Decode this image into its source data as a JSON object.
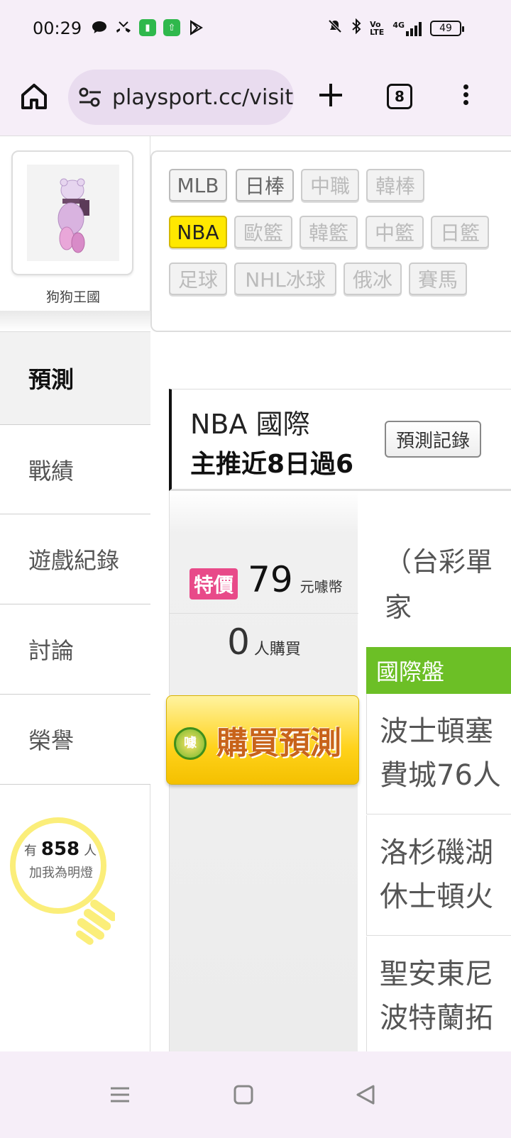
{
  "status_bar": {
    "time": "00:29",
    "battery": "49",
    "network": "4G",
    "icons": [
      "chat-bubble-icon",
      "missed-call-icon",
      "app-icon",
      "upload-icon",
      "play-store-icon",
      "mute-icon",
      "bluetooth-icon",
      "volte-icon",
      "signal-icon",
      "battery-icon"
    ]
  },
  "browser": {
    "url": "playsport.cc/visit",
    "tab_count": "8"
  },
  "sidebar": {
    "username": "狗狗王國",
    "items": [
      {
        "label": "預測",
        "active": true
      },
      {
        "label": "戰績",
        "active": false
      },
      {
        "label": "遊戲紀錄",
        "active": false
      },
      {
        "label": "討論",
        "active": false
      },
      {
        "label": "榮譽",
        "active": false
      }
    ],
    "fans": {
      "prefix": "有",
      "count": "858",
      "suffix": "人",
      "line2": "加我為明燈"
    }
  },
  "sports": [
    {
      "label": "MLB",
      "state": "enabled"
    },
    {
      "label": "日棒",
      "state": "enabled"
    },
    {
      "label": "中職",
      "state": "disabled"
    },
    {
      "label": "韓棒",
      "state": "disabled"
    },
    {
      "label": "NBA",
      "state": "selected"
    },
    {
      "label": "歐籃",
      "state": "disabled"
    },
    {
      "label": "韓籃",
      "state": "disabled"
    },
    {
      "label": "中籃",
      "state": "disabled"
    },
    {
      "label": "日籃",
      "state": "disabled"
    },
    {
      "label": "足球",
      "state": "disabled"
    },
    {
      "label": "NHL冰球",
      "state": "disabled"
    },
    {
      "label": "俄冰",
      "state": "disabled"
    },
    {
      "label": "賽馬",
      "state": "disabled"
    }
  ],
  "prediction": {
    "title": "NBA 國際",
    "subtitle": "主推近8日過6",
    "record_button": "預測記錄",
    "badge": "特價",
    "price": "79",
    "price_unit": "元噱幣",
    "buyers": "0",
    "buyers_label": "人購買",
    "buy_button": "購買預測",
    "buy_logo": "噱",
    "description": "（台彩單家",
    "pan_header": "國際盤",
    "games": [
      {
        "line1": "波士頓塞",
        "line2": "費城76人"
      },
      {
        "line1": "洛杉磯湖",
        "line2": "休士頓火"
      },
      {
        "line1": "聖安東尼",
        "line2": "波特蘭拓"
      }
    ]
  },
  "colors": {
    "selected_chip": "#ffe800",
    "badge": "#e84a89",
    "pan_header": "#6cbf26",
    "buy_button": "#ffd21a"
  }
}
